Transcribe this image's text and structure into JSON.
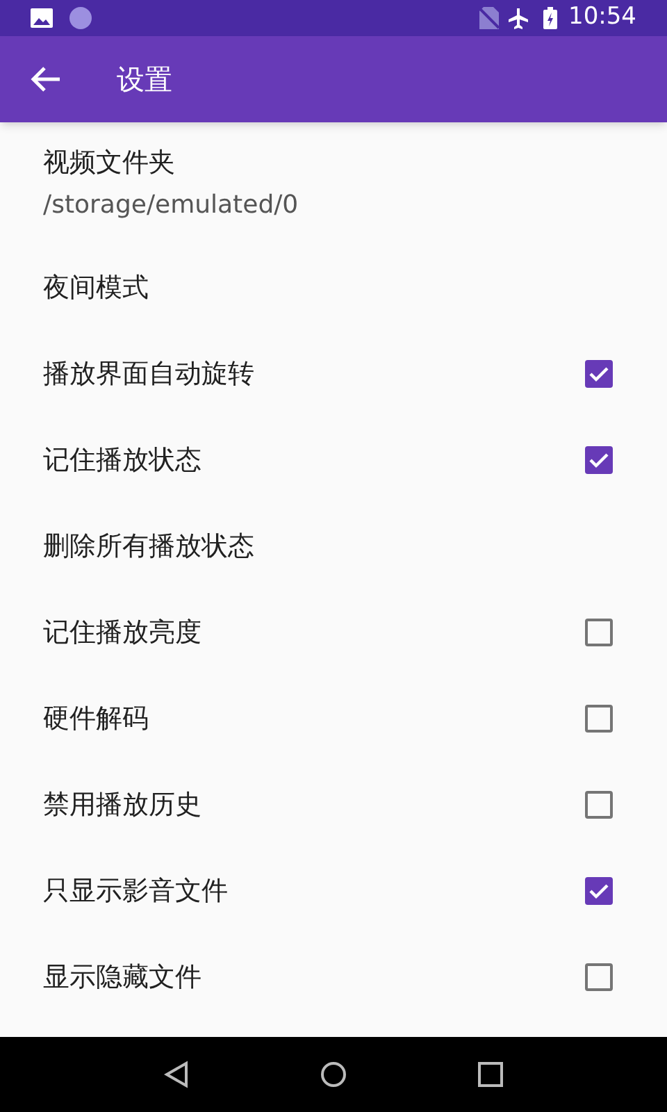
{
  "status_bar": {
    "time": "10:54"
  },
  "app_bar": {
    "title": "设置"
  },
  "settings": [
    {
      "kind": "subtitle",
      "title": "视频文件夹",
      "subtitle": "/storage/emulated/0"
    },
    {
      "kind": "plain",
      "title": "夜间模式"
    },
    {
      "kind": "checkbox",
      "title": "播放界面自动旋转",
      "checked": true
    },
    {
      "kind": "checkbox",
      "title": "记住播放状态",
      "checked": true
    },
    {
      "kind": "plain",
      "title": "删除所有播放状态"
    },
    {
      "kind": "checkbox",
      "title": "记住播放亮度",
      "checked": false
    },
    {
      "kind": "checkbox",
      "title": "硬件解码",
      "checked": false
    },
    {
      "kind": "checkbox",
      "title": "禁用播放历史",
      "checked": false
    },
    {
      "kind": "checkbox",
      "title": "只显示影音文件",
      "checked": true
    },
    {
      "kind": "checkbox",
      "title": "显示隐藏文件",
      "checked": false
    }
  ]
}
